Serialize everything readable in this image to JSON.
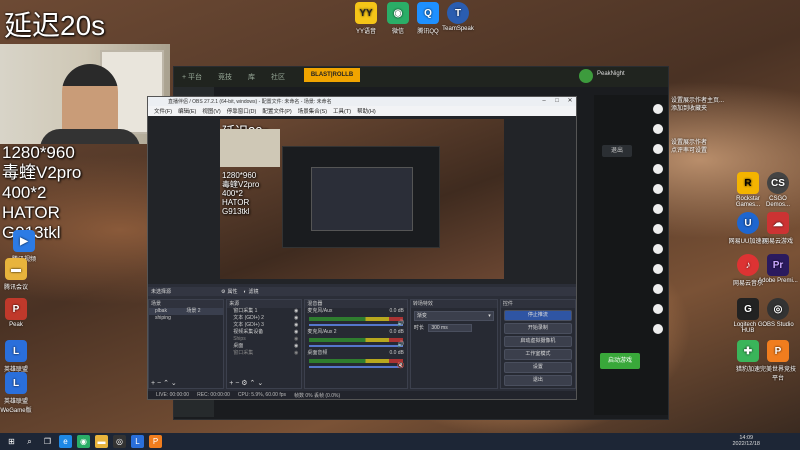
{
  "overlay": {
    "title": "延迟20s",
    "spec_lines": [
      "1280*960",
      "毒蝰V2pro",
      "400*2",
      "HATOR",
      "G913tkl"
    ]
  },
  "desktop_left_icons": [
    {
      "label": "腾讯视频",
      "icon": "video-icon",
      "color": "#2c7be5"
    },
    {
      "label": "腾讯会议",
      "icon": "folder-icon",
      "color": "#e8b43c"
    },
    {
      "label": "Peak",
      "icon": "file-icon",
      "color": "#c0392b"
    },
    {
      "label": "英雄联盟",
      "icon": "game-icon",
      "color": "#2a6fdb"
    },
    {
      "label": "英雄联盟WeGame版",
      "icon": "game-icon",
      "color": "#2a6fdb"
    }
  ],
  "desktop_top_icons": [
    {
      "label": "YY语音",
      "icon": "yy-icon",
      "color": "#f5c518"
    },
    {
      "label": "微信",
      "icon": "wechat-icon",
      "color": "#2aae67"
    },
    {
      "label": "腾讯QQ",
      "icon": "qq-icon",
      "color": "#1e90ff"
    },
    {
      "label": "TeamSpeak",
      "icon": "teamspeak-icon",
      "color": "#2a5db0"
    }
  ],
  "desktop_right_icons": [
    {
      "label": "Rockstar Games...",
      "icon": "rockstar-icon",
      "color": "#f4b400"
    },
    {
      "label": "CSGO Demos...",
      "icon": "csgo-icon",
      "color": "#444"
    },
    {
      "label": "网易UU加速器",
      "icon": "uu-icon",
      "color": "#1e66d0"
    },
    {
      "label": "网易云游戏",
      "icon": "cloudgame-icon",
      "color": "#c33"
    },
    {
      "label": "网易云音乐",
      "icon": "music-icon",
      "color": "#d33"
    },
    {
      "label": "Adobe Premi...",
      "icon": "premiere-icon",
      "color": "#2a1a5e"
    },
    {
      "label": "Logitech G HUB",
      "icon": "ghub-icon",
      "color": "#222"
    },
    {
      "label": "OBS Studio",
      "icon": "obs-icon",
      "color": "#333"
    },
    {
      "label": "猎豹加速",
      "icon": "accelerator-icon",
      "color": "#3ab55a"
    },
    {
      "label": "完美世界竞技平台",
      "icon": "perfect-icon",
      "color": "#f07d1e"
    }
  ],
  "right_notes": [
    "设置展示作者主页...",
    "添加到收藏夹",
    "设置展示作者",
    "点评率可设置"
  ],
  "client": {
    "tabs": [
      "+ 平台",
      "竞技",
      "库",
      "社区"
    ],
    "banner": "BLAST|ROLLB",
    "user": "PeakNight",
    "exit_button": "退出",
    "launch_button": "启动游戏"
  },
  "obs": {
    "title": "直播伴侣 / OBS 27.2.1 (64-bit, windows) - 配置文件: 未命名 - 场景: 未命名",
    "menus": [
      "文件(F)",
      "编辑(E)",
      "视图(V)",
      "停靠窗口(D)",
      "配置文件(P)",
      "场景集合(S)",
      "工具(T)",
      "帮助(H)"
    ],
    "scene_bar_label": "未选择源",
    "scene_bar_props": "属性",
    "scene_bar_filters": "滤镜",
    "docks": {
      "scenes_header": "场景",
      "scenes": [
        "plbak",
        "shiping"
      ],
      "scene_extra": "场景 2",
      "sources_header": "来源",
      "sources": [
        "窗口采集 1",
        "文本 (GDI+) 2",
        "文本 (GDI+) 3",
        "视频采集设备",
        "Ships",
        "桌面",
        "窗口采集"
      ],
      "mixer_header": "混音器",
      "mixer_tracks": [
        {
          "name": "麦克风/Aux",
          "db": "0.0 dB",
          "level": 0.6
        },
        {
          "name": "麦克风/Aux 2",
          "db": "0.0 dB",
          "level": 0.55
        },
        {
          "name": "桌面音频",
          "db": "0.0 dB",
          "level": 0.4
        }
      ],
      "transition_header": "转场特效",
      "transition_value": "渐变",
      "duration_label": "时长",
      "duration_value": "300 ms",
      "controls_header": "控件",
      "controls": [
        "停止推流",
        "开始录制",
        "启动虚拟摄像机",
        "工作室模式",
        "设置",
        "退出"
      ]
    },
    "status": [
      "LIVE: 00:00:00",
      "REC: 00:00:00",
      "CPU: 5.9%, 60.00 fps",
      "帧数 0% 丢帧 (0.0%)"
    ]
  },
  "taskbar": {
    "time": "14:09",
    "date": "2022/12/18"
  }
}
